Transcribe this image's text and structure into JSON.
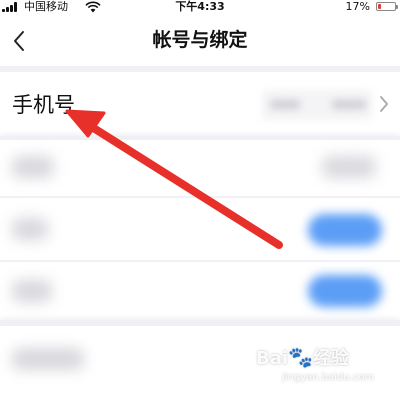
{
  "status_bar": {
    "carrier": "中国移动",
    "time": "下午4:33",
    "battery_percent": "17%",
    "battery_level": 0.17,
    "battery_color": "#e23b3b"
  },
  "nav_bar": {
    "back_icon": "chevron-left-icon",
    "title": "帐号与绑定"
  },
  "rows": [
    {
      "label": "手机号",
      "trailing_icon": "chevron-right-icon"
    }
  ],
  "annotation": {
    "type": "red-arrow",
    "color": "#e8302b"
  },
  "watermark": {
    "line2": "jingyan.baidu.com"
  },
  "colors": {
    "background": "#f2f2f6",
    "card": "#ffffff",
    "accent_blue": "#5c9ef6"
  }
}
